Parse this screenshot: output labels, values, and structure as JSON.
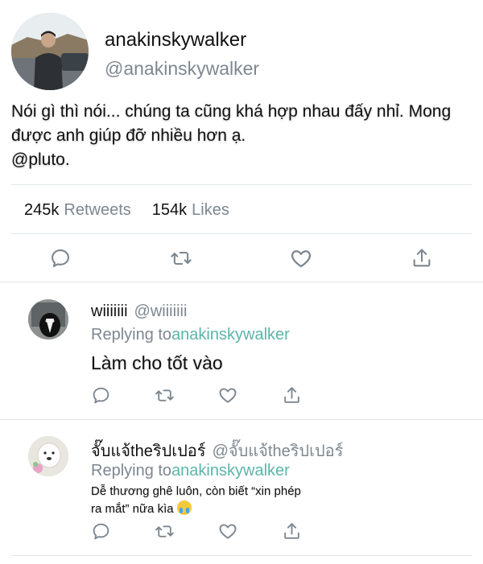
{
  "tweet": {
    "author_name": "anakinskywalker",
    "author_handle": "@anakinskywalker",
    "text_line1": "Nói gì thì nói... chúng ta cũng khá hợp nhau đấy nhỉ. Mong",
    "text_line2": "được anh giúp đỡ nhiều hơn ạ.",
    "text_line3": "@pluto.",
    "retweets_count": "245k",
    "retweets_label": "Retweets",
    "likes_count": "154k",
    "likes_label": "Likes",
    "icons": [
      "comment-icon",
      "retweet-icon",
      "heart-icon",
      "share-icon"
    ]
  },
  "replies": [
    {
      "name": "wiiiiiii",
      "handle": "@wiiiiiii",
      "replying_prefix": "Replying to",
      "replying_to": "anakinskywalker",
      "text": "Làm cho tốt vào"
    },
    {
      "name": "จั๊บแจ้theริปเปอร์",
      "handle": "@จั๊บแจ้theริปเปอร์",
      "replying_prefix": "Replying to",
      "replying_to": "anakinskywalker",
      "text_line1": "Dễ thương ghê luôn, còn biết “xin phép",
      "text_line2": "ra mắt” nữa kìa",
      "emoji": "crying-face-emoji"
    }
  ],
  "colors": {
    "link": "#5bb5a9",
    "muted": "#7d8790",
    "divider": "#e1e6ea"
  }
}
